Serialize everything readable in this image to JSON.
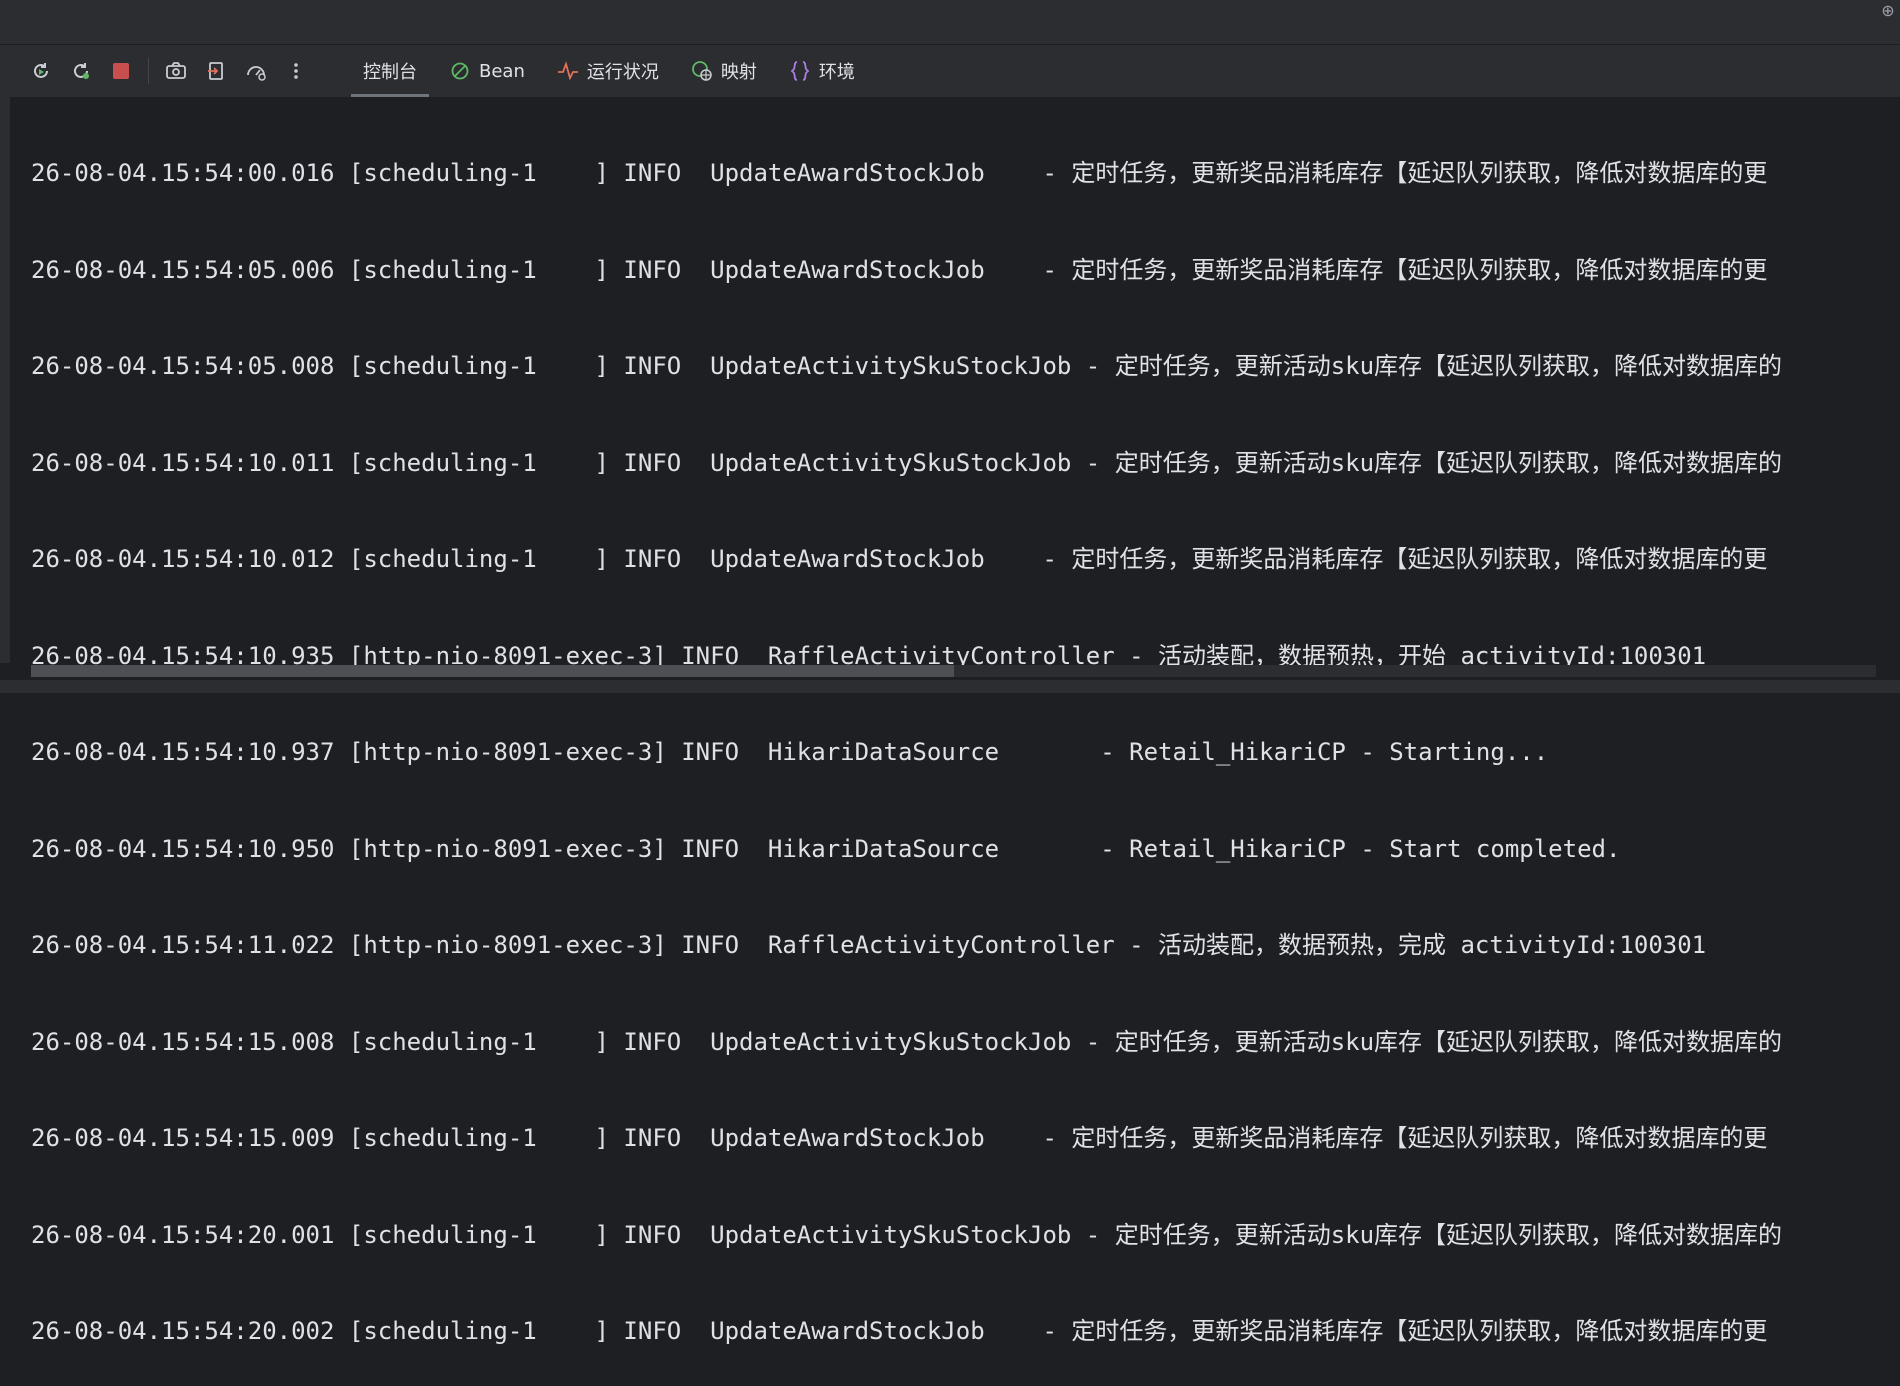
{
  "toolbar": {
    "buttons": [
      {
        "icon": "rerun-icon"
      },
      {
        "icon": "restart-icon"
      },
      {
        "icon": "stop-icon"
      },
      {
        "icon": "camera-icon"
      },
      {
        "icon": "exit-icon"
      },
      {
        "icon": "performance-icon"
      },
      {
        "icon": "more-icon"
      }
    ],
    "tabs": [
      {
        "label": "控制台",
        "icon": "",
        "active": true
      },
      {
        "label": "Bean",
        "icon": "bean-icon",
        "active": false
      },
      {
        "label": "运行状况",
        "icon": "health-icon",
        "active": false
      },
      {
        "label": "映射",
        "icon": "mapping-icon",
        "active": false
      },
      {
        "label": "环境",
        "icon": "environment-icon",
        "active": false
      }
    ]
  },
  "colors": {
    "stop": "#c94f4f",
    "rerun": "#5fb865",
    "health": "#e0715b",
    "mapping": "#5fb865",
    "environment": "#a97fe0",
    "bean": "#5fb865"
  },
  "console": {
    "lines": [
      "26-08-04.15:54:00.016 [scheduling-1    ] INFO  UpdateAwardStockJob    - 定时任务，更新奖品消耗库存【延迟队列获取，降低对数据库的更",
      "26-08-04.15:54:05.006 [scheduling-1    ] INFO  UpdateAwardStockJob    - 定时任务，更新奖品消耗库存【延迟队列获取，降低对数据库的更",
      "26-08-04.15:54:05.008 [scheduling-1    ] INFO  UpdateActivitySkuStockJob - 定时任务，更新活动sku库存【延迟队列获取，降低对数据库的",
      "26-08-04.15:54:10.011 [scheduling-1    ] INFO  UpdateActivitySkuStockJob - 定时任务，更新活动sku库存【延迟队列获取，降低对数据库的",
      "26-08-04.15:54:10.012 [scheduling-1    ] INFO  UpdateAwardStockJob    - 定时任务，更新奖品消耗库存【延迟队列获取，降低对数据库的更",
      "26-08-04.15:54:10.935 [http-nio-8091-exec-3] INFO  RaffleActivityController - 活动装配，数据预热，开始 activityId:100301",
      "26-08-04.15:54:10.937 [http-nio-8091-exec-3] INFO  HikariDataSource       - Retail_HikariCP - Starting...",
      "26-08-04.15:54:10.950 [http-nio-8091-exec-3] INFO  HikariDataSource       - Retail_HikariCP - Start completed.",
      "26-08-04.15:54:11.022 [http-nio-8091-exec-3] INFO  RaffleActivityController - 活动装配，数据预热，完成 activityId:100301",
      "26-08-04.15:54:15.008 [scheduling-1    ] INFO  UpdateActivitySkuStockJob - 定时任务，更新活动sku库存【延迟队列获取，降低对数据库的",
      "26-08-04.15:54:15.009 [scheduling-1    ] INFO  UpdateAwardStockJob    - 定时任务，更新奖品消耗库存【延迟队列获取，降低对数据库的更",
      "26-08-04.15:54:20.001 [scheduling-1    ] INFO  UpdateActivitySkuStockJob - 定时任务，更新活动sku库存【延迟队列获取，降低对数据库的",
      "26-08-04.15:54:20.002 [scheduling-1    ] INFO  UpdateAwardStockJob    - 定时任务，更新奖品消耗库存【延迟队列获取，降低对数据库的更"
    ],
    "hscroll_fraction": 0.5
  }
}
